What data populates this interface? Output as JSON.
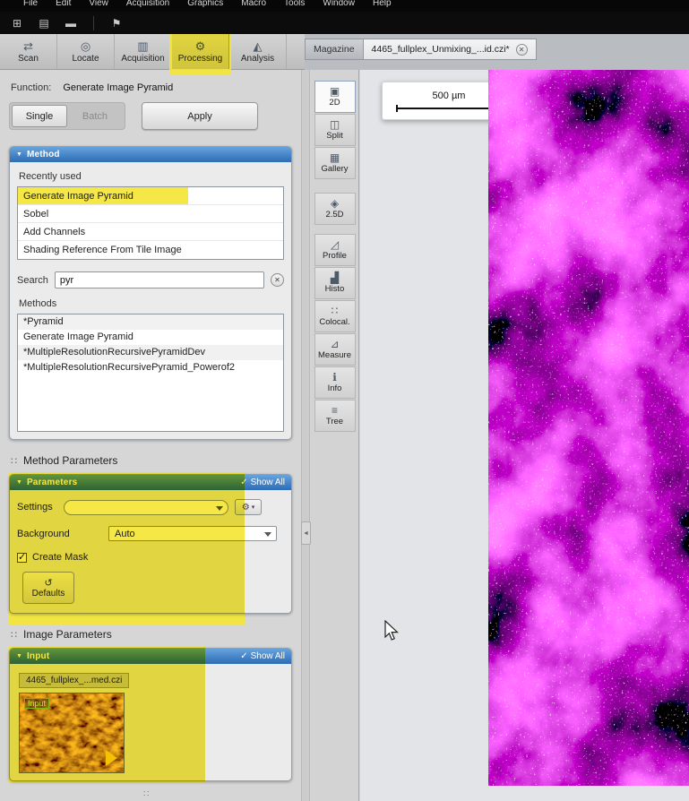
{
  "menubar": {
    "items": [
      "File",
      "Edit",
      "View",
      "Acquisition",
      "Graphics",
      "Macro",
      "Tools",
      "Window",
      "Help"
    ]
  },
  "main_tabs": [
    {
      "label": "Scan"
    },
    {
      "label": "Locate"
    },
    {
      "label": "Acquisition"
    },
    {
      "label": "Processing"
    },
    {
      "label": "Analysis"
    }
  ],
  "doc_tabs": {
    "magazine": "Magazine",
    "document": "4465_fullplex_Unmixing_...id.czi*"
  },
  "function_bar": {
    "label": "Function:",
    "value": "Generate Image Pyramid",
    "single": "Single",
    "batch": "Batch",
    "apply": "Apply"
  },
  "method": {
    "header": "Method",
    "recently_used_label": "Recently used",
    "recently_used": [
      "Generate Image Pyramid",
      "Sobel",
      "Add Channels",
      "Shading Reference From Tile Image"
    ],
    "search_label": "Search",
    "search_value": "pyr",
    "methods_label": "Methods",
    "methods": [
      "*Pyramid",
      "Generate Image Pyramid",
      "*MultipleResolutionRecursivePyramidDev",
      "*MultipleResolutionRecursivePyramid_Powerof2"
    ]
  },
  "method_parameters": {
    "section_title": "Method Parameters",
    "header": "Parameters",
    "show_all": "Show All",
    "settings_label": "Settings",
    "settings_value": "",
    "background_label": "Background",
    "background_value": "Auto",
    "create_mask_label": "Create Mask",
    "defaults_label": "Defaults"
  },
  "image_parameters": {
    "section_title": "Image Parameters",
    "header": "Input",
    "show_all": "Show All",
    "file_name": "4465_fullplex_...med.czi",
    "input_badge": "Input"
  },
  "view_strip": [
    {
      "label": "2D"
    },
    {
      "label": "Split"
    },
    {
      "label": "Gallery"
    },
    {
      "label": "2.5D"
    },
    {
      "label": "Profile"
    },
    {
      "label": "Histo"
    },
    {
      "label": "Colocal."
    },
    {
      "label": "Measure"
    },
    {
      "label": "Info"
    },
    {
      "label": "Tree"
    }
  ],
  "viewer": {
    "scale_bar_label": "500 µm"
  },
  "icons": {
    "scan": "⇄",
    "locate": "◎",
    "acquisition": "▥",
    "gear": "⚙",
    "analysis": "◭",
    "new_doc": "⊞",
    "open": "▤",
    "save": "▬",
    "flag": "⚑",
    "collapse_arrow": "▼",
    "check": "✓",
    "close": "✕",
    "undo": "↺",
    "dots": "∷",
    "chevron_left": "◄",
    "view_2d": "▣",
    "view_split": "◫",
    "view_gallery": "▦",
    "view_25d": "◈",
    "view_profile": "◿",
    "view_histo": "▟",
    "view_colocal": "∷",
    "view_measure": "⊿",
    "view_info": "ℹ",
    "view_tree": "≡"
  },
  "colors": {
    "panel_header_blue": "#2d6cb5",
    "annotation_yellow": "#f5e636",
    "image_magenta": "#cc00cc",
    "thumb_orange": "#c97a1e"
  }
}
